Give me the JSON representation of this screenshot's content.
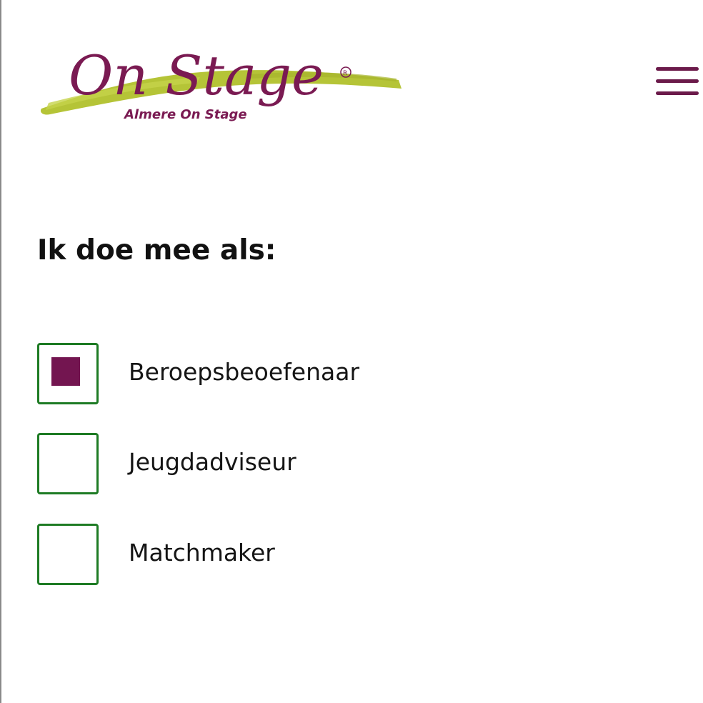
{
  "header": {
    "logo_title": "On Stage",
    "logo_subtitle": "Almere On Stage",
    "menu_icon": "hamburger-icon"
  },
  "form": {
    "question": "Ik doe mee als:",
    "options": [
      {
        "label": "Beroepsbeoefenaar",
        "checked": true
      },
      {
        "label": "Jeugdadviseur",
        "checked": false
      },
      {
        "label": "Matchmaker",
        "checked": false
      }
    ]
  },
  "colors": {
    "brand": "#731550",
    "brush": "#b5c437",
    "checkbox_border": "#1e7b24",
    "text": "#111111"
  }
}
